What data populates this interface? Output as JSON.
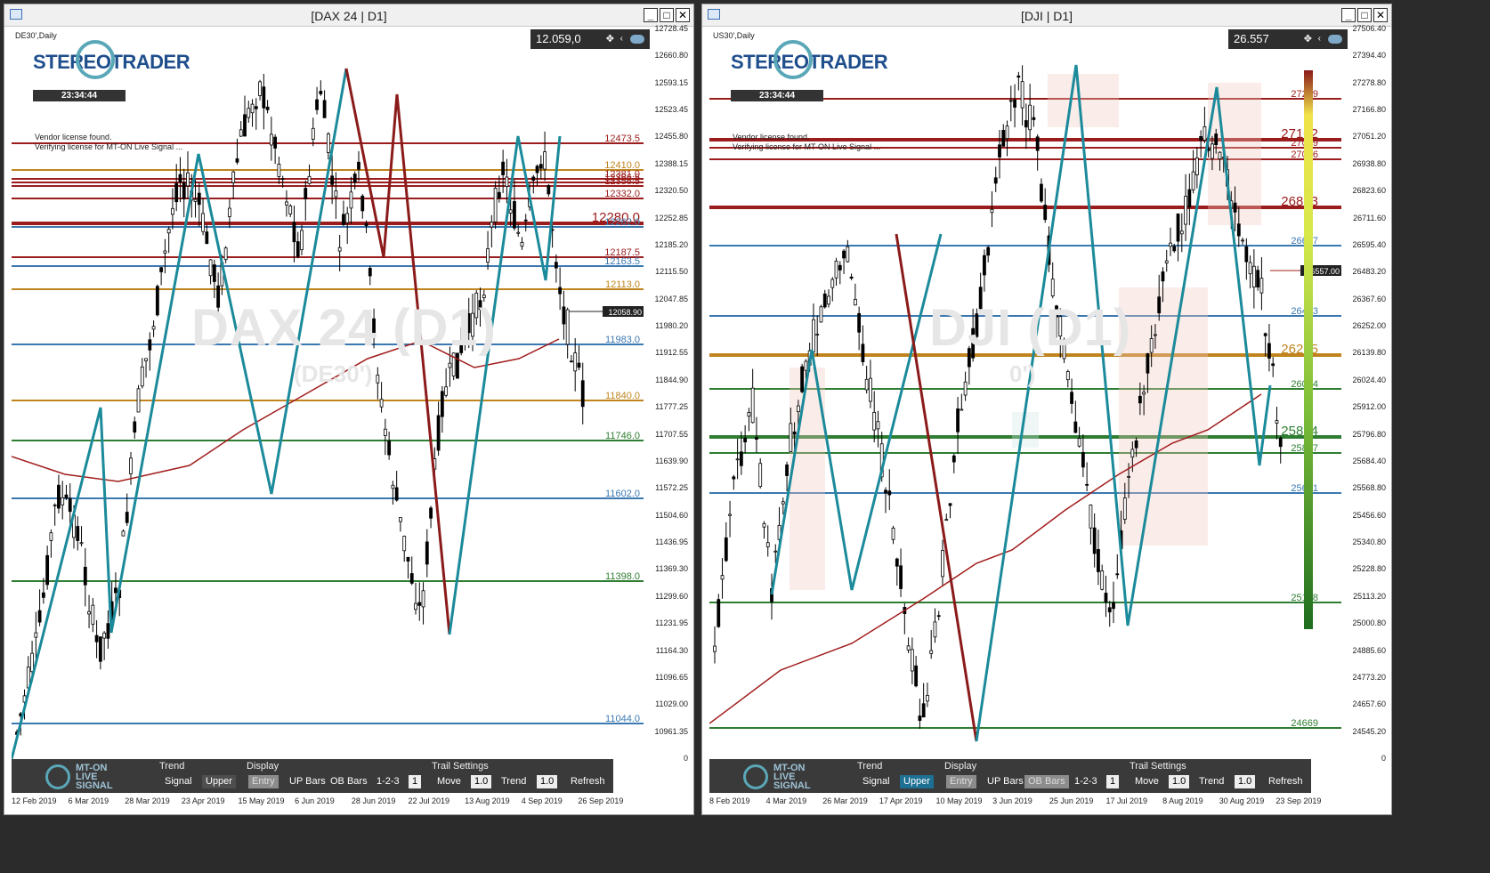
{
  "left": {
    "title": "[DAX 24 | D1]",
    "symbol_info": "DE30',Daily",
    "watermark": "DAX 24 (D1)",
    "watermark_sub": "(DE30')",
    "logo": "STEREOTRADER",
    "timer": "23:34:44",
    "price": "12.059,0",
    "license_1": "Vendor license found.",
    "license_2": "Verifying license for MT-ON Live Signal ...",
    "current_tag": "12058.90",
    "axis": [
      "12728.45",
      "12660.80",
      "12593.15",
      "12523.45",
      "12455.80",
      "12388.15",
      "12320.50",
      "12252.85",
      "12185.20",
      "12115.50",
      "12047.85",
      "11980.20",
      "11912.55",
      "11844.90",
      "11777.25",
      "11707.55",
      "11639.90",
      "11572.25",
      "11504.60",
      "11436.95",
      "11369.30",
      "11299.60",
      "11231.95",
      "11164.30",
      "11096.65",
      "11029.00",
      "10961.35",
      "0"
    ],
    "dates": [
      "12 Feb 2019",
      "6 Mar 2019",
      "28 Mar 2019",
      "23 Apr 2019",
      "15 May 2019",
      "6 Jun 2019",
      "28 Jun 2019",
      "22 Jul 2019",
      "13 Aug 2019",
      "4 Sep 2019",
      "26 Sep 2019"
    ],
    "levels": [
      {
        "label": "12473.5",
        "color": "#9b1c1c"
      },
      {
        "label": "12410.0",
        "color": "#c0841e"
      },
      {
        "label": "12381.0",
        "color": "#9b1c1c"
      },
      {
        "label": "12366.5",
        "color": "#9b1c1c"
      },
      {
        "label": "12356.5",
        "color": "#9b1c1c"
      },
      {
        "label": "12332.0",
        "color": "#9b1c1c"
      },
      {
        "label": "12280.0",
        "color": "#9b1c1c"
      },
      {
        "label": "12262.0",
        "color": "#3b78b0"
      },
      {
        "label": "12187.5",
        "color": "#9b1c1c"
      },
      {
        "label": "12163.5",
        "color": "#3b78b0"
      },
      {
        "label": "12113.0",
        "color": "#c0841e"
      },
      {
        "label": "11983.0",
        "color": "#3b78b0"
      },
      {
        "label": "11840.0",
        "color": "#c0841e"
      },
      {
        "label": "11746.0",
        "color": "#2e7d32"
      },
      {
        "label": "11602.0",
        "color": "#3b78b0"
      },
      {
        "label": "11398.0",
        "color": "#2e7d32"
      },
      {
        "label": "11044.0",
        "color": "#3b78b0"
      }
    ],
    "toolbar": {
      "trend": "Trend",
      "signal": "Signal",
      "upper": "Upper",
      "display": "Display",
      "entry": "Entry",
      "up_bars": "UP Bars",
      "ob_bars": "OB Bars",
      "one_two_three": "1-2-3",
      "one": "1",
      "trail": "Trail Settings",
      "move": "Move",
      "move_val": "1.0",
      "trend2": "Trend",
      "trend_val": "1.0",
      "refresh": "Refresh",
      "logo": [
        "MT-ON",
        "LIVE",
        "SIGNAL"
      ]
    }
  },
  "right": {
    "title": "[DJI | D1]",
    "symbol_info": "US30',Daily",
    "watermark": "DJI (D1)",
    "watermark_sub": "0')",
    "logo": "STEREOTRADER",
    "timer": "23:34:44",
    "price": "26.557",
    "license_1": "Vendor license found.",
    "license_2": "Verifying license for MT-ON Live Signal ...",
    "current_tag": "26557.00",
    "axis": [
      "27506.40",
      "27394.40",
      "27278.80",
      "27166.80",
      "27051.20",
      "26938.80",
      "26823.60",
      "26711.60",
      "26595.40",
      "26483.20",
      "26367.60",
      "26252.00",
      "26139.80",
      "26024.40",
      "25912.00",
      "25796.80",
      "25684.40",
      "25568.80",
      "25456.60",
      "25340.80",
      "25228.80",
      "25113.20",
      "25000.80",
      "24885.60",
      "24773.20",
      "24657.60",
      "24545.20",
      "0"
    ],
    "dates": [
      "8 Feb 2019",
      "4 Mar 2019",
      "26 Mar 2019",
      "17 Apr 2019",
      "10 May 2019",
      "3 Jun 2019",
      "25 Jun 2019",
      "17 Jul 2019",
      "8 Aug 2019",
      "30 Aug 2019",
      "23 Sep 2019"
    ],
    "levels": [
      {
        "label": "27259",
        "color": "#9b1c1c"
      },
      {
        "label": "27102",
        "color": "#9b1c1c"
      },
      {
        "label": "27059",
        "color": "#9b1c1c"
      },
      {
        "label": "27016",
        "color": "#9b1c1c"
      },
      {
        "label": "26823",
        "color": "#9b1c1c"
      },
      {
        "label": "26667",
        "color": "#3b78b0"
      },
      {
        "label": "26413",
        "color": "#3b78b0"
      },
      {
        "label": "26215",
        "color": "#c0841e"
      },
      {
        "label": "26074",
        "color": "#2e7d32"
      },
      {
        "label": "25874",
        "color": "#2e7d32"
      },
      {
        "label": "25807",
        "color": "#2e7d32"
      },
      {
        "label": "25641",
        "color": "#3b78b0"
      },
      {
        "label": "25188",
        "color": "#2e7d32"
      },
      {
        "label": "24669",
        "color": "#2e7d32"
      }
    ],
    "toolbar": {
      "trend": "Trend",
      "signal": "Signal",
      "upper": "Upper",
      "display": "Display",
      "entry": "Entry",
      "up_bars": "UP Bars",
      "ob_bars": "OB Bars",
      "one_two_three": "1-2-3",
      "one": "1",
      "trail": "Trail Settings",
      "move": "Move",
      "move_val": "1.0",
      "trend2": "Trend",
      "trend_val": "1.0",
      "refresh": "Refresh",
      "logo": [
        "MT-ON",
        "LIVE",
        "SIGNAL"
      ]
    }
  },
  "window_buttons": {
    "min": "_",
    "max": "□",
    "close": "✕"
  }
}
